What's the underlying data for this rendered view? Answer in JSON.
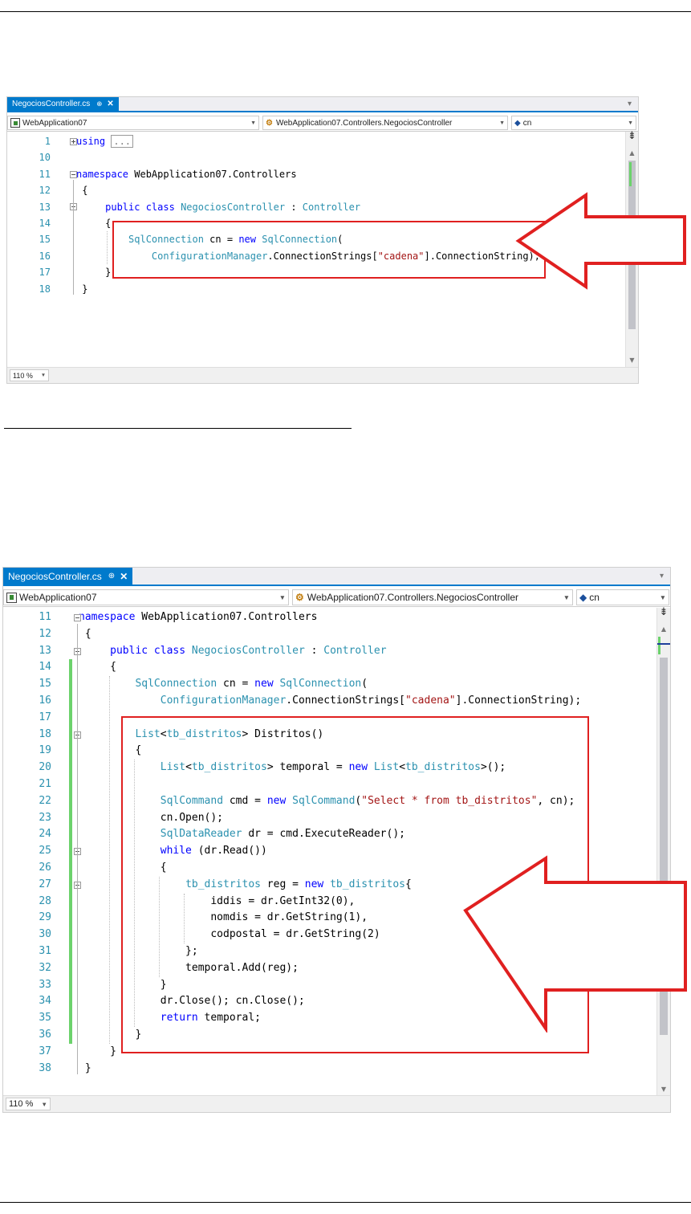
{
  "shot1": {
    "tab": {
      "title": "NegociosController.cs",
      "pin": "⊕",
      "close": "✕"
    },
    "nav": {
      "project": "WebApplication07",
      "class": "WebApplication07.Controllers.NegociosController",
      "member": "cn"
    },
    "zoom": "110 %",
    "lines": [
      {
        "n": "1",
        "html": "<span class='kw'>using</span> <span class='cm' style='border:1px solid #999;padding:0 2px;'>...</span>"
      },
      {
        "n": "10",
        "html": ""
      },
      {
        "n": "11",
        "html": "<span class='kw'>namespace</span> WebApplication07.Controllers"
      },
      {
        "n": "12",
        "html": " {"
      },
      {
        "n": "13",
        "html": "     <span class='kw'>public class</span> <span class='ty'>NegociosController</span> : <span class='ty'>Controller</span>"
      },
      {
        "n": "14",
        "html": "     {"
      },
      {
        "n": "15",
        "html": "         <span class='ty'>SqlConnection</span> cn = <span class='kw'>new</span> <span class='ty'>SqlConnection</span>("
      },
      {
        "n": "16",
        "html": "             <span class='ty'>ConfigurationManager</span>.ConnectionStrings[<span class='st'>\"cadena\"</span>].ConnectionString);"
      },
      {
        "n": "17",
        "html": "     }"
      },
      {
        "n": "18",
        "html": " }"
      }
    ]
  },
  "shot2": {
    "tab": {
      "title": "NegociosController.cs",
      "pin": "⊕",
      "close": "✕"
    },
    "nav": {
      "project": "WebApplication07",
      "class": "WebApplication07.Controllers.NegociosController",
      "member": "cn"
    },
    "zoom": "110 %",
    "lines": [
      {
        "n": "11",
        "html": "<span class='kw'>namespace</span> WebApplication07.Controllers"
      },
      {
        "n": "12",
        "html": " {"
      },
      {
        "n": "13",
        "html": "     <span class='kw'>public class</span> <span class='ty'>NegociosController</span> : <span class='ty'>Controller</span>"
      },
      {
        "n": "14",
        "html": "     {"
      },
      {
        "n": "15",
        "html": "         <span class='ty'>SqlConnection</span> cn = <span class='kw'>new</span> <span class='ty'>SqlConnection</span>("
      },
      {
        "n": "16",
        "html": "             <span class='ty'>ConfigurationManager</span>.ConnectionStrings[<span class='st'>\"cadena\"</span>].ConnectionString);"
      },
      {
        "n": "17",
        "html": ""
      },
      {
        "n": "18",
        "html": "         <span class='ty'>List</span>&lt;<span class='ty'>tb_distritos</span>&gt; Distritos()"
      },
      {
        "n": "19",
        "html": "         {"
      },
      {
        "n": "20",
        "html": "             <span class='ty'>List</span>&lt;<span class='ty'>tb_distritos</span>&gt; temporal = <span class='kw'>new</span> <span class='ty'>List</span>&lt;<span class='ty'>tb_distritos</span>&gt;();"
      },
      {
        "n": "21",
        "html": ""
      },
      {
        "n": "22",
        "html": "             <span class='ty'>SqlCommand</span> cmd = <span class='kw'>new</span> <span class='ty'>SqlCommand</span>(<span class='st'>\"Select * from tb_distritos\"</span>, cn);"
      },
      {
        "n": "23",
        "html": "             cn.Open();"
      },
      {
        "n": "24",
        "html": "             <span class='ty'>SqlDataReader</span> dr = cmd.ExecuteReader();"
      },
      {
        "n": "25",
        "html": "             <span class='kw'>while</span> (dr.Read())"
      },
      {
        "n": "26",
        "html": "             {"
      },
      {
        "n": "27",
        "html": "                 <span class='ty'>tb_distritos</span> reg = <span class='kw'>new</span> <span class='ty'>tb_distritos</span>{"
      },
      {
        "n": "28",
        "html": "                     iddis = dr.GetInt32(0),"
      },
      {
        "n": "29",
        "html": "                     nomdis = dr.GetString(1),"
      },
      {
        "n": "30",
        "html": "                     codpostal = dr.GetString(2)"
      },
      {
        "n": "31",
        "html": "                 };"
      },
      {
        "n": "32",
        "html": "                 temporal.Add(reg);"
      },
      {
        "n": "33",
        "html": "             }"
      },
      {
        "n": "34",
        "html": "             dr.Close(); cn.Close();"
      },
      {
        "n": "35",
        "html": "             <span class='kw'>return</span> temporal;"
      },
      {
        "n": "36",
        "html": "         }"
      },
      {
        "n": "37",
        "html": "     }"
      },
      {
        "n": "38",
        "html": " }"
      }
    ]
  },
  "colors": {
    "highlight": "#e02020",
    "tab_accent": "#007acc",
    "line_numbers": "#2b91af",
    "keyword": "#0000ff",
    "type": "#2b91af",
    "string": "#a31515"
  }
}
